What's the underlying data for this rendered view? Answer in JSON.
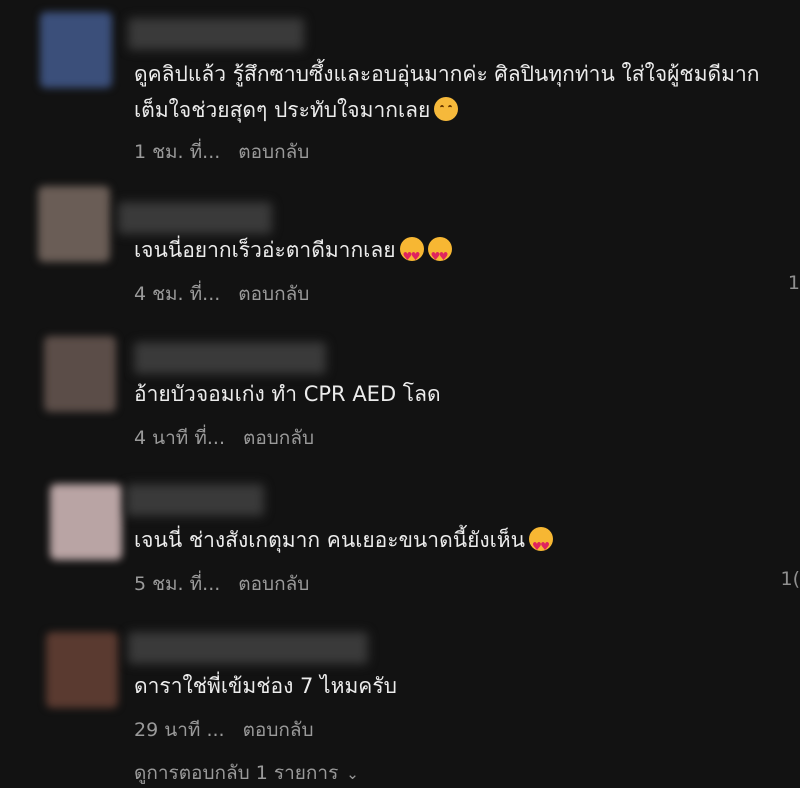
{
  "comments": [
    {
      "text": "ดูคลิปแล้ว รู้สึกซาบซึ้งและอบอุ่นมากค่ะ ศิลปินทุกท่าน ใส่ใจผู้ชมดีมาก เต็มใจช่วยสุดๆ ประทับใจมากเลย",
      "emojis": [
        "smiling-face-icon"
      ],
      "time": "1 ชม. ที่...",
      "reply": "ตอบกลับ",
      "avatar_color": "#3b4f7a",
      "side_count": ""
    },
    {
      "text": "เจนนี่อยากเร็วอ่ะตาดีมากเลย",
      "emojis": [
        "smiling-face-with-hearts-icon",
        "smiling-face-with-hearts-icon"
      ],
      "time": "4 ชม. ที่...",
      "reply": "ตอบกลับ",
      "avatar_color": "#6a5d56",
      "side_count": "1"
    },
    {
      "text": "อ้ายบัวจอมเก่ง ทำ CPR AED โลด",
      "emojis": [],
      "time": "4 นาที ที่...",
      "reply": "ตอบกลับ",
      "avatar_color": "#5b4d48",
      "side_count": ""
    },
    {
      "text": "เจนนี่ ช่างสังเกตุมาก คนเยอะขนาดนี้ยังเห็น",
      "emojis": [
        "smiling-face-with-hearts-icon"
      ],
      "time": "5 ชม. ที่...",
      "reply": "ตอบกลับ",
      "avatar_color": "#b9a4a4",
      "side_count": "1("
    },
    {
      "text": "ดาราใช่พี่เข้มช่อง 7 ไหมครับ",
      "emojis": [],
      "time": "29 นาที ...",
      "reply": "ตอบกลับ",
      "avatar_color": "#5a3a30",
      "side_count": ""
    }
  ],
  "view_replies": "ดูการตอบกลับ 1 รายการ",
  "colors": {
    "background": "#121212",
    "text": "#ececec",
    "muted": "#9a9a9a"
  }
}
